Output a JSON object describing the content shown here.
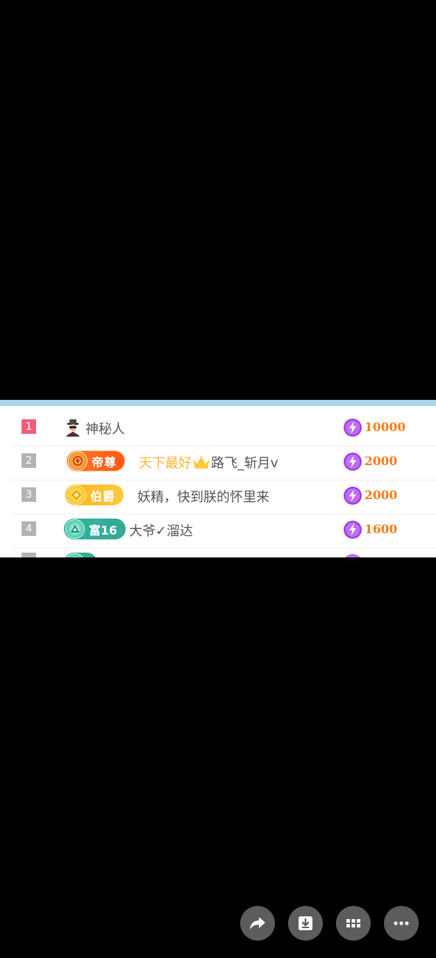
{
  "ranking": {
    "rows": [
      {
        "rank": "1",
        "name": "神秘人",
        "amount": "10000"
      },
      {
        "rank": "2",
        "badge": "帝尊",
        "name_highlight": "天下最好",
        "name": "路飞_斩月v",
        "amount": "2000"
      },
      {
        "rank": "3",
        "badge": "伯爵",
        "name": "妖精，快到朕的怀里来",
        "amount": "2000"
      },
      {
        "rank": "4",
        "badge": "富16",
        "name": "大爷✓溜达",
        "amount": "1600"
      }
    ]
  },
  "colors": {
    "rank_first": "#f25c7c",
    "rank_other": "#b3b3b3",
    "amount": "#ff7a1a",
    "top_strip": "#a9d4ea"
  },
  "toolbar": {
    "icons": [
      "share-icon",
      "download-icon",
      "grid-icon",
      "more-icon"
    ]
  }
}
